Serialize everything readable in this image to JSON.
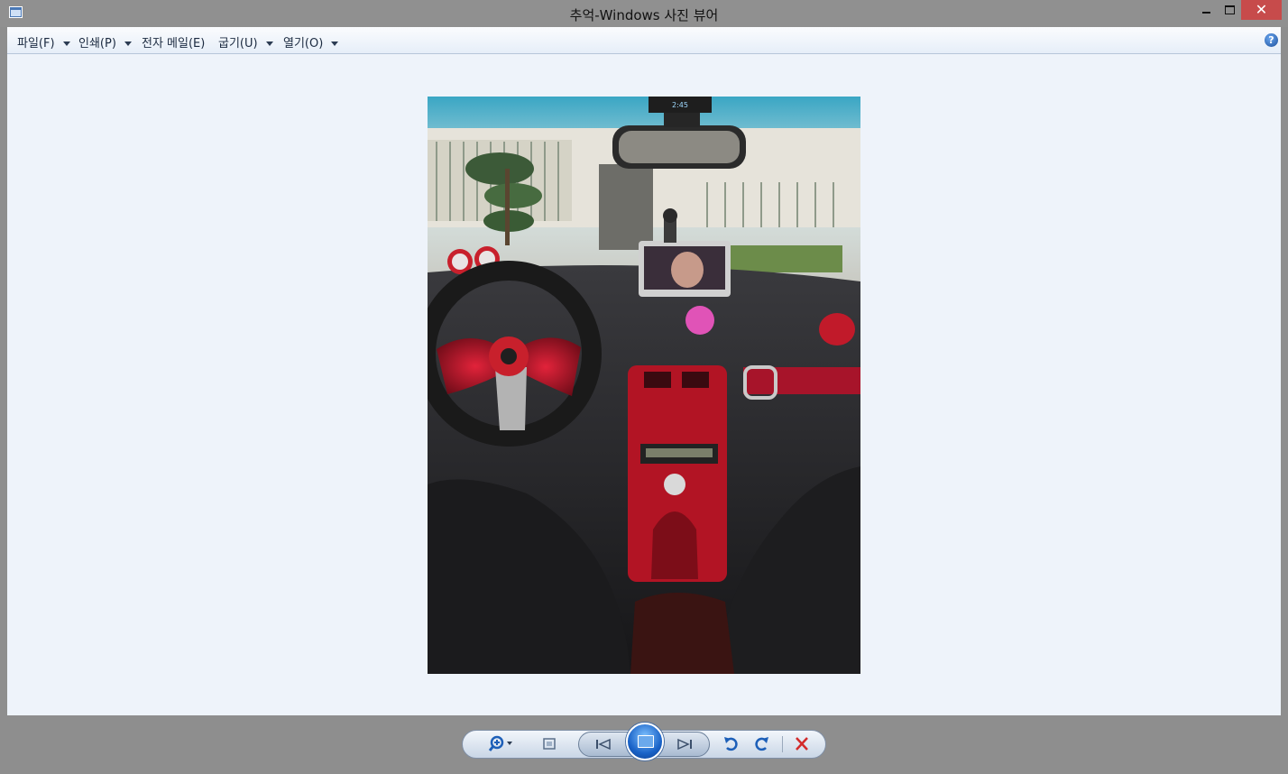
{
  "window": {
    "title": "추억-Windows 사진 뷰어"
  },
  "menu": {
    "items": [
      {
        "label": "파일(F)",
        "has_dropdown": true
      },
      {
        "label": "인쇄(P)",
        "has_dropdown": true
      },
      {
        "label": "전자 메일(E)",
        "has_dropdown": false
      },
      {
        "label": "굽기(U)",
        "has_dropdown": true
      },
      {
        "label": "열기(O)",
        "has_dropdown": true
      }
    ],
    "help_icon": "help-icon"
  },
  "photo": {
    "subject": "car-interior-photo",
    "clock_text": "2:45"
  },
  "controls": {
    "zoom": "zoom-icon",
    "actual_size": "actual-size-icon",
    "previous": "previous-icon",
    "slideshow": "slideshow-icon",
    "next": "next-icon",
    "rotate_left": "rotate-counterclockwise-icon",
    "rotate_right": "rotate-clockwise-icon",
    "delete": "delete-icon"
  },
  "colors": {
    "frame": "#8e8e8e",
    "viewer_bg": "#eef3fa",
    "close": "#c74b4b",
    "delete_x": "#d32a2a",
    "rotate_blue": "#1d5fb8"
  }
}
